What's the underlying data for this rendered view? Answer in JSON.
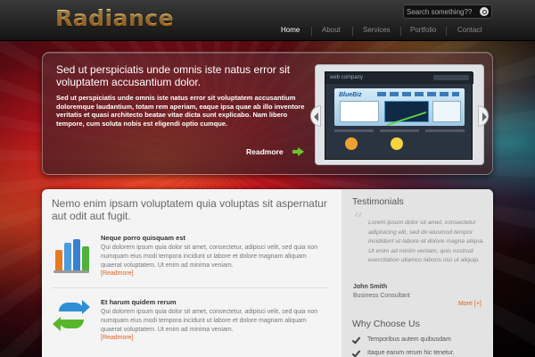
{
  "header": {
    "logo": "Radiance",
    "search_placeholder": "Search something??",
    "nav": [
      "Home",
      "About",
      "Services",
      "Portfolio",
      "Contact"
    ],
    "active_nav": "Home"
  },
  "slider": {
    "title": "Sed ut perspiciatis unde omnis iste natus error sit voluptatem accusantium dolor.",
    "text": "Sed ut perspiciatis unde omnis iste natus error sit voluptatem accusantium doloremque laudantium, totam rem aperiam, eaque ipsa quae ab illo inventore veritatis et quasi architecto beatae vitae dicta sunt explicabo. Nam libero tempore, cum soluta nobis est eligendi optio cumque.",
    "readmore": "Readmore",
    "preview": {
      "site_name": "web company",
      "brand": "BlueBiz"
    }
  },
  "main": {
    "heading": "Nemo enim ipsam voluptatem quia voluptas sit aspernatur aut odit aut fugit.",
    "features": [
      {
        "title": "Neque porro quisquam est",
        "text": "Qui dolorem ipsum quia dolor sit amet, consectetur, adipisci velit, sed quia non numquam eius modi tempora incidunt ut labore et dolore magnam aliquam quaerat voluptatem. Ut enim ad minima veniam.",
        "link": "[Readmore]",
        "icon": "bar-chart-icon"
      },
      {
        "title": "Et harum quidem rerum",
        "text": "Qui dolorem ipsum quia dolor sit amet, consectetur, adipisci velit, sed quia non numquam eius modi tempora incidunt ut labore et dolore magnam aliquam quaerat voluptatem. Ut enim ad minima veniam.",
        "link": "[Readmore]",
        "icon": "refresh-arrows-icon"
      }
    ]
  },
  "sidebar": {
    "testimonials_title": "Testimonials",
    "quote": "Lorem ipsum dolor sit amet, consectetur adipisicing elit, sed do eiusmod tempor incididunt ut labore et dolore magna aliqua. Ut enim ad minim veniam, quis nostrud exercitation ullamco laboris nisi ut aliquip.",
    "author": "John Smith",
    "role": "Business Consultant",
    "more": "More [+]",
    "why_title": "Why Choose Us",
    "why_items": [
      "Temporibus autem quibusdam",
      "Itaque earum rerum hic tenetur."
    ]
  },
  "colors": {
    "accent_orange": "#e0601a",
    "readmore_arrow_green": "#6fc22d",
    "logo_gradient": [
      "#ffe39a",
      "#e98a18"
    ]
  }
}
